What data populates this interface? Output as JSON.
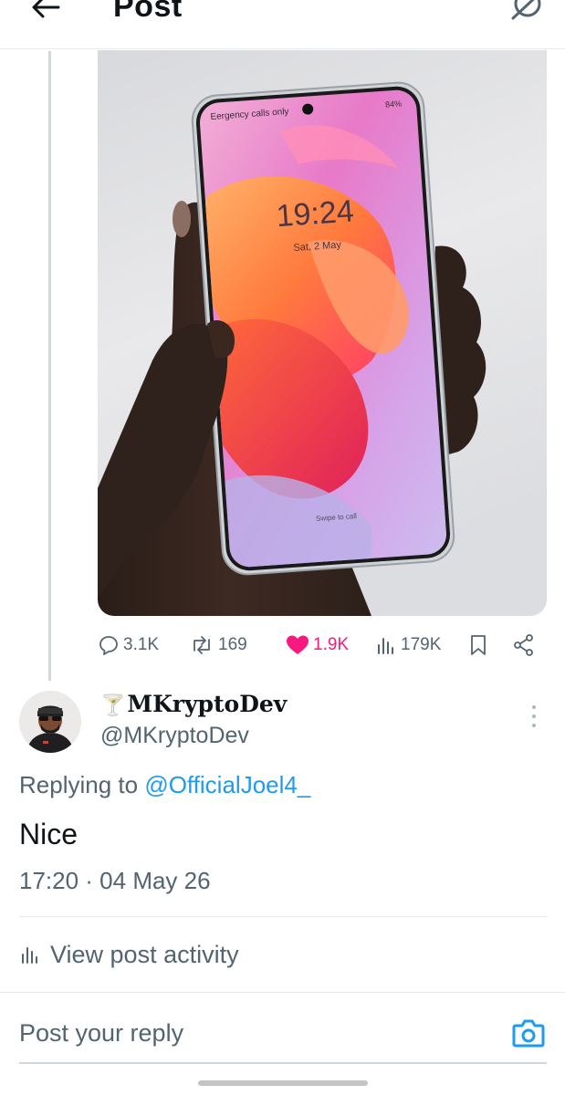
{
  "header": {
    "title": "Post"
  },
  "post": {
    "image": {
      "screen_status_left": "Eergency calls only",
      "screen_status_right": "84%",
      "screen_time": "19:24",
      "screen_date": "Sat, 2 May",
      "screen_bottom": "Swipe to call"
    },
    "actions": {
      "replies": "3.1K",
      "reposts": "169",
      "likes": "1.9K",
      "views": "179K"
    }
  },
  "reply": {
    "display_name_emoji": "🍸",
    "display_name": "MKryptoDev",
    "handle": "@MKryptoDev",
    "replying_label": "Replying to ",
    "replying_mention": "@OfficialJoel4_",
    "text": "Nice",
    "timestamp": "17:20 · 04 May 26"
  },
  "activity": {
    "label": "View post activity"
  },
  "compose": {
    "placeholder": "Post your reply"
  },
  "colors": {
    "accent": "#1d9bf0",
    "like": "#f91880",
    "muted": "#536471",
    "text": "#0f1419"
  }
}
